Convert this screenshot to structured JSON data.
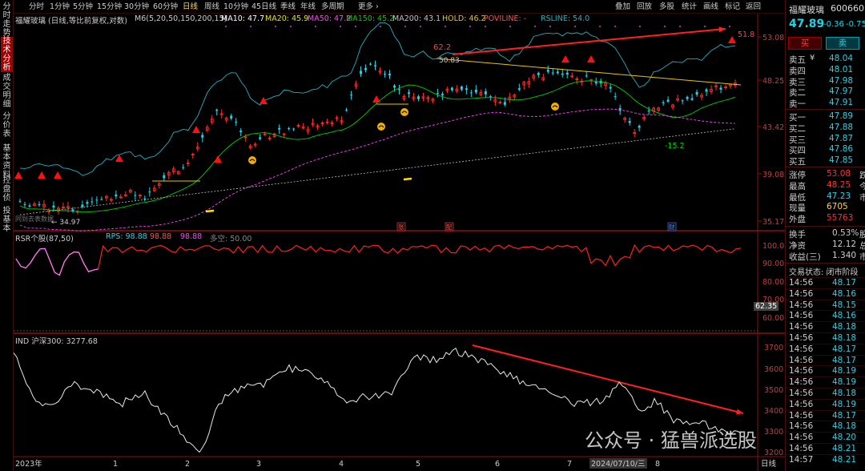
{
  "left_tabs": [
    "分时走势",
    "技术分析",
    "成交明细",
    "分价表",
    "基本资料",
    "控盘侦",
    "投基本"
  ],
  "toolbar": {
    "items": [
      "分时",
      "1分钟",
      "5分钟",
      "15分钟",
      "30分钟",
      "60分钟",
      "日线",
      "周线",
      "10分钟",
      "45日线",
      "季线",
      "年线",
      "多周期",
      "更多 ›"
    ],
    "active": "日线",
    "tools": [
      "叠加",
      "回放",
      "多股",
      "统计",
      "画线",
      "标记",
      "返回"
    ]
  },
  "colors": {
    "up": "#ff3030",
    "down": "#23d1e6",
    "ma5": "#ffffff",
    "ma20": "#e5e500",
    "ma50": "#ff44ff",
    "ma150": "#00d000",
    "ma200": "#c0c0c0",
    "hold": "#e8c700",
    "poviline": "#ff5050",
    "rsline": "#23b0c0",
    "accent": "#a00000"
  },
  "main_chart": {
    "title": "福耀玻璃 (日线,等比前复权,对数)",
    "indicator": "M6(5,20,50,150,200,15)",
    "legends": [
      {
        "label": "MA10: 47.7",
        "color": "#ffffff"
      },
      {
        "label": "MA20: 45.9",
        "color": "#e5e500"
      },
      {
        "label": "MA50: 47.2",
        "color": "#ff44ff"
      },
      {
        "label": "MA150: 45.2",
        "color": "#00d000"
      },
      {
        "label": "MA200: 43.1",
        "color": "#c0c0c0"
      },
      {
        "label": "HOLD: 46.2",
        "color": "#e8c700"
      },
      {
        "label": "POVILINE: -",
        "color": "#ff5050"
      },
      {
        "label": "RSLINE: 54.0",
        "color": "#23b0c0"
      }
    ],
    "y_ticks": [
      "53.08",
      "48.25",
      "43.42",
      "39.08",
      "35.17"
    ],
    "annotations": {
      "high_label": "62.2",
      "peak_label": "50.83",
      "right_label": "51.8",
      "low_label": "-15.2",
      "start_low": "← 34.97",
      "past_caption": "同到去表数据"
    },
    "event_markers": [
      "张",
      "配",
      "财"
    ]
  },
  "rsr_panel": {
    "title": "RSR个股(87,50)",
    "title_color": "#cccccc",
    "values": [
      {
        "label": "RPS: 98.88",
        "color": "#23d1e6"
      },
      {
        "label": "98.88",
        "color": "#ff5050"
      },
      {
        "label": "98.88",
        "color": "#ff44ff"
      },
      {
        "label": "多空: 50.00",
        "color": "#888888"
      }
    ],
    "y_ticks": [
      "100.0",
      "90.00",
      "80.00",
      "70.00",
      "60.00"
    ],
    "marker_value": "62.35"
  },
  "ind_panel": {
    "title": "IND 沪深300: 3277.68",
    "y_ticks": [
      "3700",
      "3600",
      "3500",
      "3400",
      "3300",
      "3200"
    ]
  },
  "time_axis": {
    "labels": [
      "2023年",
      "1",
      "2",
      "3",
      "4",
      "5",
      "6",
      "7",
      "2024/07/10/三",
      "8",
      "日线"
    ]
  },
  "stock": {
    "name": "福耀玻璃",
    "code": "600660",
    "price": "47.89",
    "change": "-0.36",
    "pct": "-0.75",
    "buy": "买",
    "sell": "卖"
  },
  "order_book": {
    "asks": [
      {
        "label": "卖五",
        "flag": "¥",
        "price": "48.04"
      },
      {
        "label": "卖四",
        "price": "48.01"
      },
      {
        "label": "卖三",
        "price": "47.98"
      },
      {
        "label": "卖二",
        "price": "47.97"
      },
      {
        "label": "卖一",
        "price": "47.91"
      }
    ],
    "bids": [
      {
        "label": "买一",
        "price": "47.89"
      },
      {
        "label": "买二",
        "price": "47.88"
      },
      {
        "label": "买三",
        "price": "47.87"
      },
      {
        "label": "买四",
        "price": "47.86"
      },
      {
        "label": "买五",
        "price": "47.85"
      }
    ]
  },
  "stats": [
    {
      "label": "涨停",
      "value": "53.08",
      "value_color": "#ff3030",
      "extra": "跌"
    },
    {
      "label": "最高",
      "value": "48.25",
      "value_color": "#ff3030",
      "extra": "今"
    },
    {
      "label": "最低",
      "value": "47.23",
      "value_color": "#23d1e6",
      "extra": "市"
    },
    {
      "label": "现量",
      "value": "6705",
      "value_color": "#ffd24a",
      "extra": ""
    },
    {
      "label": "外盘",
      "value": "55763",
      "value_color": "#ff3030",
      "extra": ""
    }
  ],
  "stats2": [
    {
      "label": "换手",
      "value": "0.53%",
      "extra": "股"
    },
    {
      "label": "净资",
      "value": "12.12",
      "extra": "总"
    },
    {
      "label": "收益(三)",
      "value": "1.340",
      "extra": "市"
    }
  ],
  "trade_status": "交易状态: 闭市阶段",
  "ticks": [
    {
      "time": "14:56",
      "price": "48.17"
    },
    {
      "time": "14:56",
      "price": "48.16"
    },
    {
      "time": "14:56",
      "price": "48.15"
    },
    {
      "time": "14:56",
      "price": "48.16"
    },
    {
      "time": "14:56",
      "price": "48.18"
    },
    {
      "time": "14:56",
      "price": "48.18"
    },
    {
      "time": "14:56",
      "price": "48.17"
    },
    {
      "time": "14:56",
      "price": "48.17"
    },
    {
      "time": "14:56",
      "price": "48.19"
    },
    {
      "time": "14:56",
      "price": "48.19"
    },
    {
      "time": "14:56",
      "price": "48.18"
    },
    {
      "time": "14:56",
      "price": "48.19"
    },
    {
      "time": "14:56",
      "price": "48.17"
    },
    {
      "time": "14:56",
      "price": "48.18"
    },
    {
      "time": "14:56",
      "price": "48.20"
    },
    {
      "time": "14:56",
      "price": "48.21"
    },
    {
      "time": "14:57",
      "price": "48.21"
    }
  ],
  "watermark": "公众号 · 猛兽派选股"
}
